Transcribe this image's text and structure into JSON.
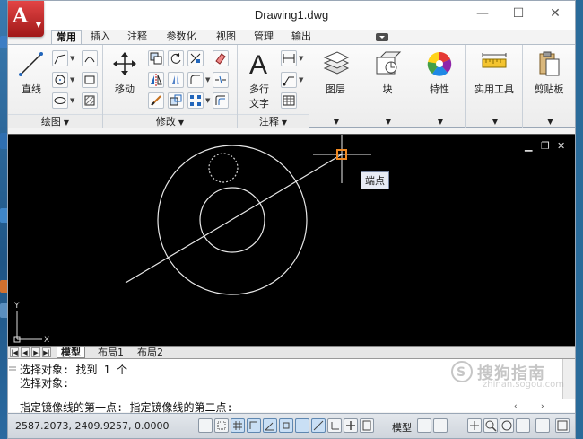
{
  "window": {
    "title": "Drawing1.dwg",
    "controls": {
      "minimize": "—",
      "maximize": "☐",
      "close": "✕"
    }
  },
  "ribbon": {
    "tabs": [
      {
        "label": "常用",
        "active": true
      },
      {
        "label": "插入"
      },
      {
        "label": "注释"
      },
      {
        "label": "参数化"
      },
      {
        "label": "视图"
      },
      {
        "label": "管理"
      },
      {
        "label": "输出"
      }
    ],
    "panels": {
      "draw": {
        "label": "绘图",
        "line_label": "直线"
      },
      "modify": {
        "label": "修改",
        "move_label": "移动"
      },
      "annotation": {
        "label": "注释",
        "mtext_label_line1": "多行",
        "mtext_label_line2": "文字"
      },
      "layers": {
        "label": "图层"
      },
      "block": {
        "label": "块"
      },
      "properties": {
        "label": "特性"
      },
      "utilities": {
        "label": "实用工具"
      },
      "clipboard": {
        "label": "剪贴板"
      }
    }
  },
  "drawing": {
    "tooltip": "端点",
    "ucs": {
      "x": "X",
      "y": "Y"
    }
  },
  "layout_tabs": [
    {
      "label": "模型",
      "active": true
    },
    {
      "label": "布局1"
    },
    {
      "label": "布局2"
    }
  ],
  "command": {
    "history": [
      "选择对象: 找到 1 个",
      "选择对象:"
    ],
    "prompt": "指定镜像线的第一点: 指定镜像线的第二点:"
  },
  "watermark": {
    "text": "搜狗指南",
    "url": "zhinan.sogou.com"
  },
  "status": {
    "coordinates": "2587.2073,   2409.9257, 0.0000",
    "space": "模型"
  },
  "colors": {
    "app_button": "#c62828",
    "osnap_marker": "#f08a24",
    "canvas": "#000000"
  }
}
